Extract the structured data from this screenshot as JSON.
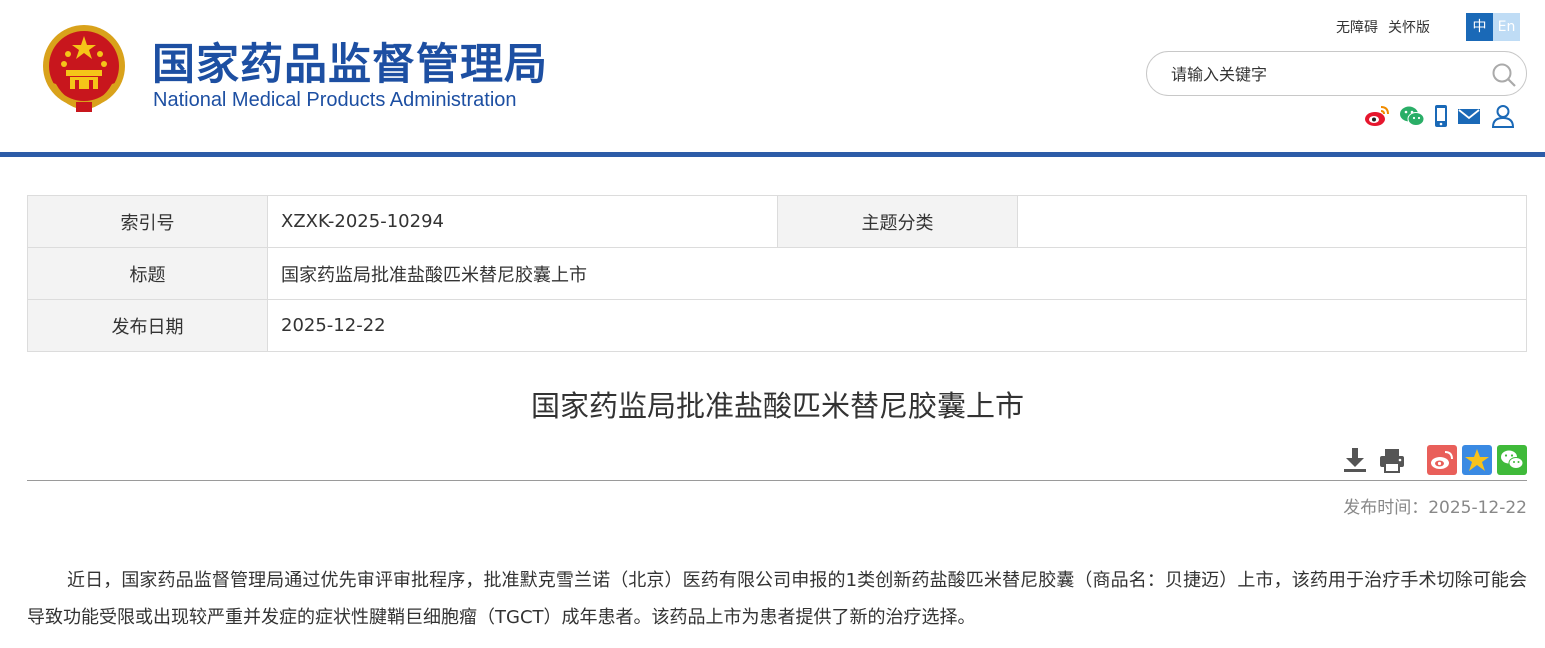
{
  "header": {
    "title_cn": "国家药品监督管理局",
    "title_en": "National Medical Products Administration",
    "links": [
      "无障碍",
      "关怀版"
    ],
    "lang_zh": "中",
    "lang_en": "En",
    "search_placeholder": "请输入关键字",
    "brand_color": "#1d4fa2",
    "social_icons": [
      "weibo-icon",
      "wechat-icon",
      "mobile-icon",
      "mail-icon",
      "user-icon"
    ]
  },
  "info": {
    "index_label": "索引号",
    "index_value": "XZXK-2025-10294",
    "category_label": "主题分类",
    "category_value": "",
    "title_label": "标题",
    "title_value": "国家药监局批准盐酸匹米替尼胶囊上市",
    "date_label": "发布日期",
    "date_value": "2025-12-22"
  },
  "article": {
    "title": "国家药监局批准盐酸匹米替尼胶囊上市",
    "publish_time": "发布时间：2025-12-22",
    "body": "近日，国家药品监督管理局通过优先审评审批程序，批准默克雪兰诺（北京）医药有限公司申报的1类创新药盐酸匹米替尼胶囊（商品名：贝捷迈）上市，该药用于治疗手术切除可能会导致功能受限或出现较严重并发症的症状性腱鞘巨细胞瘤（TGCT）成年患者。该药品上市为患者提供了新的治疗选择。",
    "tool_icons": [
      "download-icon",
      "print-icon",
      "share-weibo-icon",
      "share-qzone-icon",
      "share-wechat-icon"
    ]
  }
}
